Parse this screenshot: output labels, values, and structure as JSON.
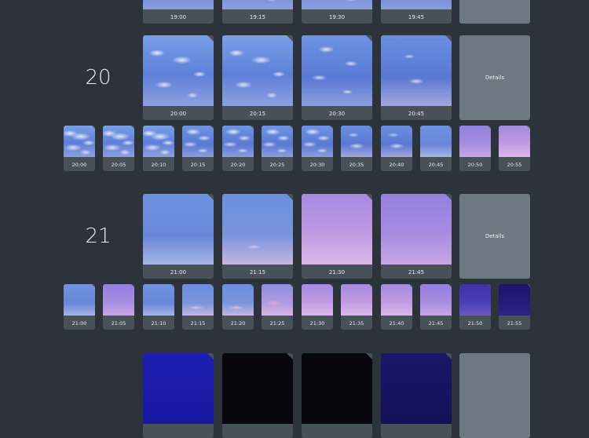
{
  "top_partial": {
    "cards": [
      "19:00",
      "19:15",
      "19:30",
      "19:45"
    ]
  },
  "sections": [
    {
      "hour": "20",
      "details_label": "Details",
      "big": [
        "20:00",
        "20:15",
        "20:30",
        "20:45"
      ],
      "small": [
        "20:00",
        "20:05",
        "20:10",
        "20:15",
        "20:20",
        "20:25",
        "20:30",
        "20:35",
        "20:40",
        "20:45",
        "20:50",
        "20:55"
      ]
    },
    {
      "hour": "21",
      "details_label": "Details",
      "big": [
        "21:00",
        "21:15",
        "21:30",
        "21:45"
      ],
      "small": [
        "21:00",
        "21:05",
        "21:10",
        "21:15",
        "21:20",
        "21:25",
        "21:30",
        "21:35",
        "21:40",
        "21:45",
        "21:50",
        "21:55"
      ]
    }
  ],
  "colors": {
    "background": "#2c333a",
    "card": "#485058",
    "details_button": "#6d7980"
  }
}
